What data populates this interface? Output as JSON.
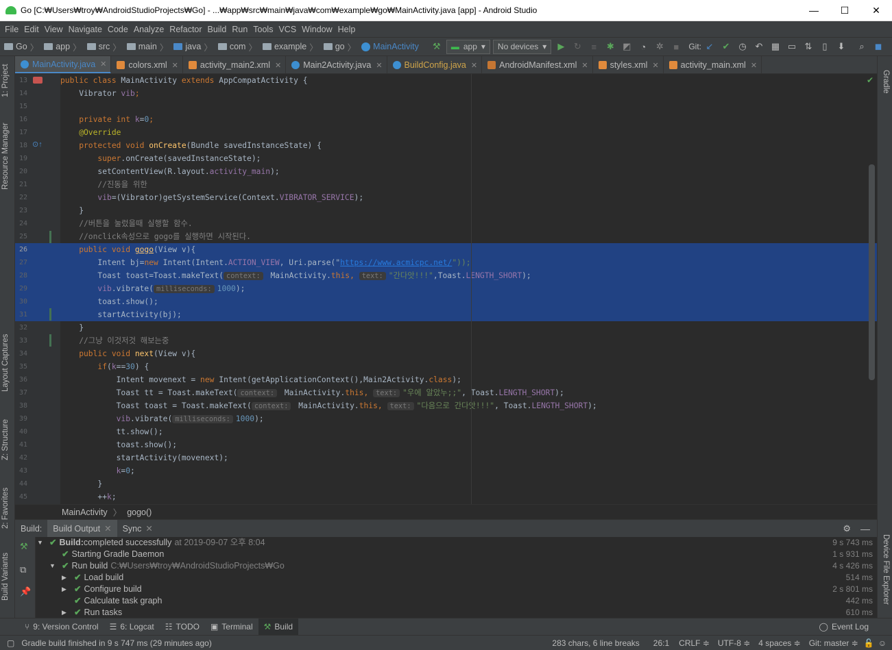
{
  "window": {
    "title": "Go [C:₩Users₩troy₩AndroidStudioProjects₩Go] - ...₩app₩src₩main₩java₩com₩example₩go₩MainActivity.java [app] - Android Studio",
    "min": "—",
    "max": "☐",
    "close": "✕"
  },
  "menu": [
    "File",
    "Edit",
    "View",
    "Navigate",
    "Code",
    "Analyze",
    "Refactor",
    "Build",
    "Run",
    "Tools",
    "VCS",
    "Window",
    "Help"
  ],
  "nav": {
    "crumbs": [
      "Go",
      "app",
      "src",
      "main",
      "java",
      "com",
      "example",
      "go",
      "MainActivity"
    ],
    "config": "app",
    "device": "No devices",
    "git": "Git:"
  },
  "tabs": [
    {
      "label": "MainActivity.java",
      "color": "#3d8fd1"
    },
    {
      "label": "colors.xml",
      "color": "#e08a3c"
    },
    {
      "label": "activity_main2.xml",
      "color": "#e08a3c"
    },
    {
      "label": "Main2Activity.java",
      "color": "#3d8fd1"
    },
    {
      "label": "BuildConfig.java",
      "color": "#3d8fd1"
    },
    {
      "label": "AndroidManifest.xml",
      "color": "#c57633"
    },
    {
      "label": "styles.xml",
      "color": "#e08a3c"
    },
    {
      "label": "activity_main.xml",
      "color": "#e08a3c"
    }
  ],
  "left_tools": {
    "project": "1: Project",
    "resource": "Resource Manager",
    "layout": "Layout Captures",
    "structure": "Z: Structure",
    "favorites": "2: Favorites",
    "variants": "Build Variants"
  },
  "right_tools": {
    "gradle": "Gradle",
    "device": "Device File Explorer"
  },
  "line_numbers": [
    "13",
    "14",
    "15",
    "16",
    "17",
    "18",
    "19",
    "20",
    "21",
    "22",
    "23",
    "24",
    "25",
    "26",
    "27",
    "28",
    "29",
    "30",
    "31",
    "32",
    "33",
    "34",
    "35",
    "36",
    "37",
    "38",
    "39",
    "40",
    "41",
    "42",
    "43",
    "44",
    "45"
  ],
  "code": {
    "l13": {
      "a": "public class ",
      "b": "MainActivity ",
      "c": "extends ",
      "d": "AppCompatActivity {"
    },
    "l14": {
      "a": "    Vibrator ",
      "b": "vib",
      "c": ";"
    },
    "l16": {
      "a": "    private int ",
      "b": "k",
      "c": "=",
      "d": "0",
      "e": ";"
    },
    "l17": {
      "a": "    @Override"
    },
    "l18": {
      "a": "    protected void ",
      "b": "onCreate",
      "c": "(Bundle savedInstanceState) {"
    },
    "l19": {
      "a": "        super",
      "b": ".onCreate(savedInstanceState);"
    },
    "l20": {
      "a": "        setContentView(R.layout.",
      "b": "activity_main",
      "c": ");"
    },
    "l21": {
      "a": "        //진동을 위한"
    },
    "l22": {
      "a": "        vib",
      "b": "=(Vibrator)getSystemService(Context.",
      "c": "VIBRATOR_SERVICE",
      "d": ");"
    },
    "l23": {
      "a": "    }"
    },
    "l24": {
      "a": "    //버튼을 눌렀을때 실행할 함수."
    },
    "l25": {
      "a": "    //onclick속성으로 gogo를 실행하면 시작된다."
    },
    "l26": {
      "a": "    public void ",
      "b": "gogo",
      "c": "(View v){"
    },
    "l27": {
      "a": "        Intent bj=",
      "b": "new ",
      "c": "Intent(Intent.",
      "d": "ACTION_VIEW",
      "e": ", Uri.parse(\"",
      "f": "https://www.acmicpc.net/",
      "g": "\"));"
    },
    "l28": {
      "a": "        Toast toast=Toast.makeText(",
      "h1": "context:",
      "b": " MainActivity.",
      "c": "this",
      "d": ", ",
      "h2": "text:",
      "e": "\"간다앗!!!\"",
      "f": ",Toast.",
      "g": "LENGTH_SHORT",
      "i": ");"
    },
    "l29": {
      "a": "        vib",
      "b": ".vibrate(",
      "h": "milliseconds:",
      "c": "1000",
      "d": ");"
    },
    "l30": {
      "a": "        toast.show();"
    },
    "l31": {
      "a": "        startActivity(bj);"
    },
    "l32": {
      "a": "    }"
    },
    "l33": {
      "a": "    //그냥 이것저것 해보는중"
    },
    "l34": {
      "a": "    public void ",
      "b": "next",
      "c": "(View v){"
    },
    "l35": {
      "a": "        if",
      "b": "(",
      "c": "k",
      "d": "==",
      "e": "30",
      "f": ") {"
    },
    "l36": {
      "a": "            Intent movenext = ",
      "b": "new ",
      "c": "Intent(getApplicationContext(),Main2Activity.",
      "d": "class",
      "e": ");"
    },
    "l37": {
      "a": "            Toast tt = Toast.makeText(",
      "h1": "context:",
      "b": " MainActivity.",
      "c": "this",
      "d": ", ",
      "h2": "text:",
      "e": "\"우에 알았누;;\"",
      "f": ", Toast.",
      "g": "LENGTH_SHORT",
      "i": ");"
    },
    "l38": {
      "a": "            Toast toast = Toast.makeText(",
      "h1": "context:",
      "b": " MainActivity.",
      "c": "this",
      "d": ", ",
      "h2": "text:",
      "e": "\"다음으로 간다앗!!!\"",
      "f": ", Toast.",
      "g": "LENGTH_SHORT",
      "i": ");"
    },
    "l39": {
      "a": "            vib",
      "b": ".vibrate(",
      "h": "milliseconds:",
      "c": "1000",
      "d": ");"
    },
    "l40": {
      "a": "            tt.show();"
    },
    "l41": {
      "a": "            toast.show();"
    },
    "l42": {
      "a": "            startActivity(movenext);"
    },
    "l43": {
      "a": "            k",
      "b": "=",
      "c": "0",
      "d": ";"
    },
    "l44": {
      "a": "        }"
    },
    "l45": {
      "a": "        ++",
      "b": "k",
      "c": ";"
    }
  },
  "breadcrumb": [
    "MainActivity",
    "gogo()"
  ],
  "build": {
    "tabs": [
      "Build:",
      "Build Output",
      "Sync"
    ],
    "rows": [
      {
        "label": "Build:",
        "text": " completed successfully",
        "dim": "at 2019-09-07 오후 8:04",
        "time": "9 s 743 ms"
      },
      {
        "label": "Starting Gradle Daemon",
        "time": "1 s 931 ms"
      },
      {
        "label": "Run build",
        "dim": "C:₩Users₩troy₩AndroidStudioProjects₩Go",
        "time": "4 s 426 ms"
      },
      {
        "label": "Load build",
        "time": "514 ms"
      },
      {
        "label": "Configure build",
        "time": "2 s 801 ms"
      },
      {
        "label": "Calculate task graph",
        "time": "442 ms"
      },
      {
        "label": "Run tasks",
        "time": "610 ms"
      }
    ]
  },
  "toolwindows": [
    "9: Version Control",
    "6: Logcat",
    "TODO",
    "Terminal",
    "Build",
    "Event Log"
  ],
  "status": {
    "message": "Gradle build finished in 9 s 747 ms (29 minutes ago)",
    "chars": "283 chars, 6 line breaks",
    "pos": "26:1",
    "crlf": "CRLF ≑",
    "enc": "UTF-8 ≑",
    "indent": "4 spaces ≑",
    "git": "Git: master ≑"
  }
}
